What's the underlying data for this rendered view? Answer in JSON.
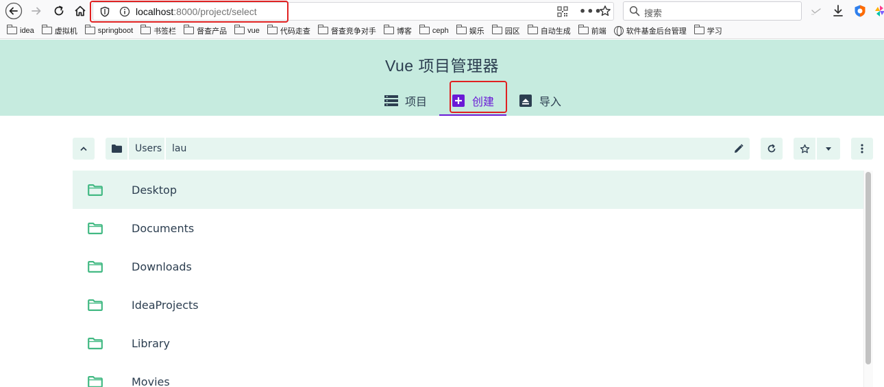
{
  "browser": {
    "url_host": "localhost",
    "url_path": ":8000/project/select",
    "search_placeholder": "搜索"
  },
  "bookmarks": [
    {
      "label": "idea",
      "icon": "folder-icon"
    },
    {
      "label": "虚拟机",
      "icon": "folder-icon"
    },
    {
      "label": "springboot",
      "icon": "folder-icon"
    },
    {
      "label": "书签栏",
      "icon": "folder-icon"
    },
    {
      "label": "督查产品",
      "icon": "folder-icon"
    },
    {
      "label": "vue",
      "icon": "folder-icon"
    },
    {
      "label": "代码走查",
      "icon": "folder-icon"
    },
    {
      "label": "督查竞争对手",
      "icon": "folder-icon"
    },
    {
      "label": "博客",
      "icon": "folder-icon"
    },
    {
      "label": "ceph",
      "icon": "folder-icon"
    },
    {
      "label": "娱乐",
      "icon": "folder-icon"
    },
    {
      "label": "园区",
      "icon": "folder-icon"
    },
    {
      "label": "自动生成",
      "icon": "folder-icon"
    },
    {
      "label": "前端",
      "icon": "folder-icon"
    },
    {
      "label": "软件基金后台管理",
      "icon": "globe-icon"
    },
    {
      "label": "学习",
      "icon": "folder-icon"
    }
  ],
  "app": {
    "title": "Vue 项目管理器",
    "tabs": [
      {
        "label": "项目",
        "icon": "list-icon",
        "active": false
      },
      {
        "label": "创建",
        "icon": "plus-box-icon",
        "active": true
      },
      {
        "label": "导入",
        "icon": "upload-icon",
        "active": false
      }
    ],
    "accent_color": "#6a1ad6",
    "header_bg": "#c6ebdf"
  },
  "path": {
    "segments": [
      "Users",
      "lau"
    ]
  },
  "folders": [
    {
      "name": "Desktop",
      "selected": true
    },
    {
      "name": "Documents",
      "selected": false
    },
    {
      "name": "Downloads",
      "selected": false
    },
    {
      "name": "IdeaProjects",
      "selected": false
    },
    {
      "name": "Library",
      "selected": false
    },
    {
      "name": "Movies",
      "selected": false
    }
  ]
}
